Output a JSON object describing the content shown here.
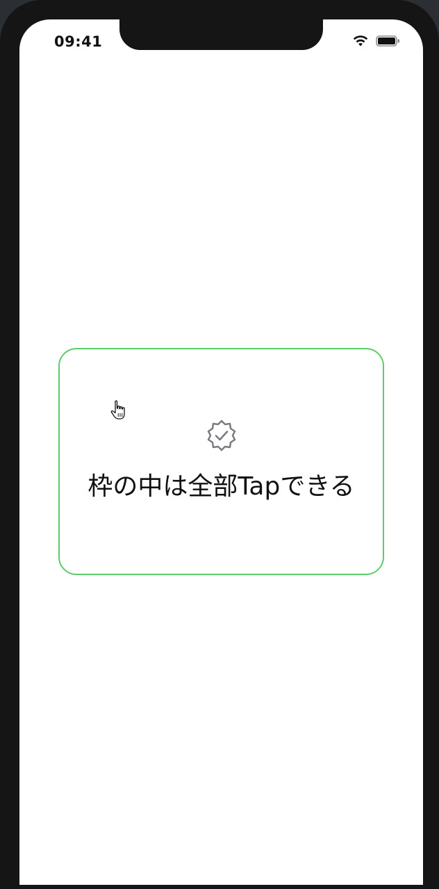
{
  "status_bar": {
    "time": "09:41",
    "wifi_icon": "wifi-icon",
    "battery_icon": "battery-icon"
  },
  "card": {
    "icon": "verified-badge-icon",
    "label": "枠の中は全部Tapできる",
    "border_color": "#5ccc69"
  },
  "cursor_icon": "hand-pointer-icon"
}
